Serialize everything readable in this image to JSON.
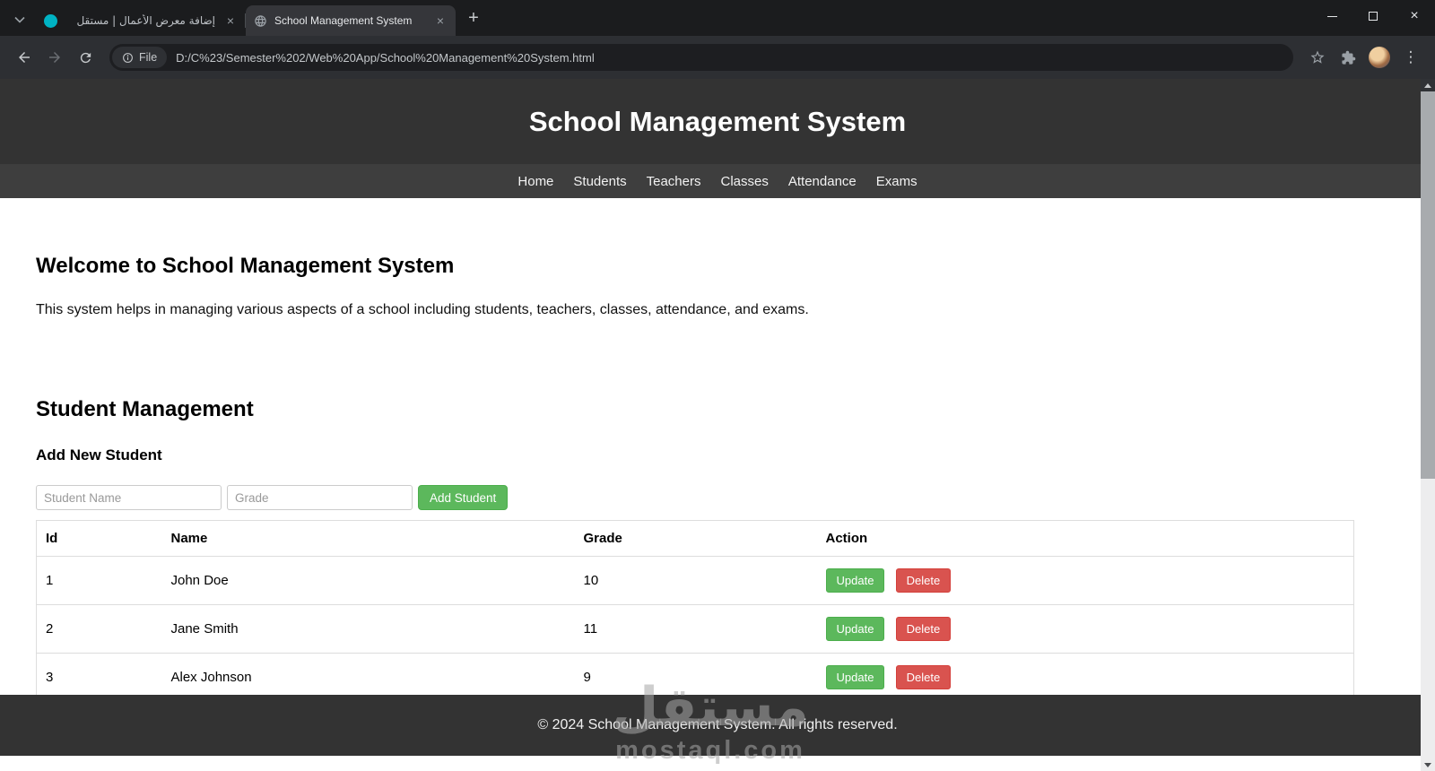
{
  "browser": {
    "tabs": [
      {
        "title": "إضافة معرض الأعمال | مستقل",
        "active": false
      },
      {
        "title": "School Management System",
        "active": true
      }
    ],
    "file_badge": "File",
    "url": "D:/C%23/Semester%202/Web%20App/School%20Management%20System.html",
    "icons": {
      "close_tab": "×",
      "new_tab": "+",
      "menu": "⋮",
      "window_close": "×"
    }
  },
  "page": {
    "header_title": "School Management System",
    "nav_items": [
      "Home",
      "Students",
      "Teachers",
      "Classes",
      "Attendance",
      "Exams"
    ],
    "welcome": {
      "heading": "Welcome to School Management System",
      "description": "This system helps in managing various aspects of a school including students, teachers, classes, attendance, and exams."
    },
    "students": {
      "heading": "Student Management",
      "add_heading": "Add New Student",
      "name_placeholder": "Student Name",
      "grade_placeholder": "Grade",
      "add_button": "Add Student",
      "table": {
        "headers": [
          "Id",
          "Name",
          "Grade",
          "Action"
        ],
        "rows": [
          {
            "id": "1",
            "name": "John Doe",
            "grade": "10"
          },
          {
            "id": "2",
            "name": "Jane Smith",
            "grade": "11"
          },
          {
            "id": "3",
            "name": "Alex Johnson",
            "grade": "9"
          }
        ],
        "update_label": "Update",
        "delete_label": "Delete"
      }
    },
    "footer": "© 2024 School Management System. All rights reserved.",
    "watermark": {
      "arabic": "مستقل",
      "latin": "mostaql.com"
    }
  },
  "colors": {
    "accent_green": "#5cb85c",
    "accent_red": "#d9534f",
    "header_bg": "#333333",
    "nav_bg": "#3e3e3e",
    "favicon_teal": "#00b3c4"
  }
}
